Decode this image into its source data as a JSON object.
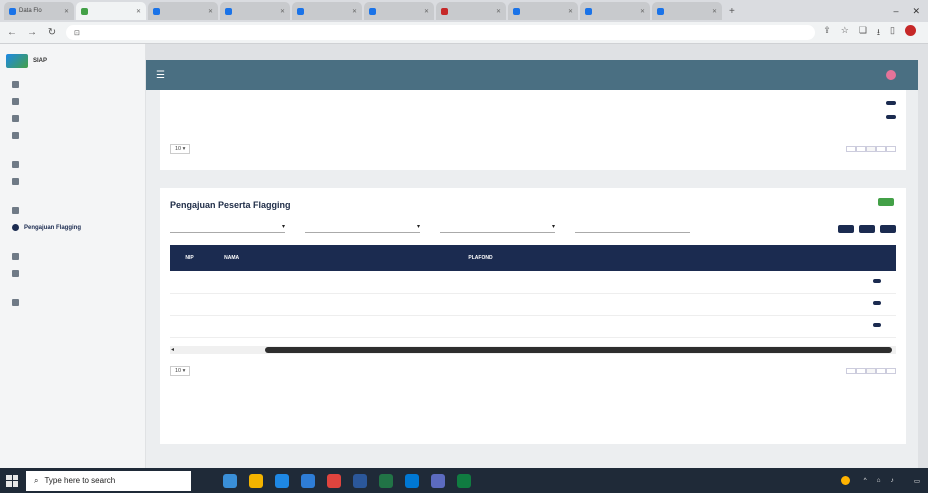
{
  "browser": {
    "tabs": [
      {
        "label": "Data Flo",
        "active": false
      },
      {
        "label": "",
        "active": true
      },
      {
        "label": "",
        "active": false
      },
      {
        "label": "",
        "active": false
      },
      {
        "label": "",
        "active": false
      },
      {
        "label": "",
        "active": false
      },
      {
        "label": "",
        "active": false
      },
      {
        "label": "",
        "active": false
      },
      {
        "label": "",
        "active": false
      },
      {
        "label": "",
        "active": false
      }
    ],
    "url": ""
  },
  "app": {
    "brand_title": "SIAP",
    "brand_subtitle": ""
  },
  "sidebar": {
    "items": [
      {
        "label": "",
        "type": "item"
      },
      {
        "label": "",
        "type": "item"
      },
      {
        "label": "",
        "type": "item"
      },
      {
        "label": "",
        "type": "item"
      },
      {
        "label": "",
        "type": "group"
      },
      {
        "label": "",
        "type": "item"
      },
      {
        "label": "",
        "type": "item"
      },
      {
        "label": "",
        "type": "group"
      },
      {
        "label": "",
        "type": "item"
      },
      {
        "label": "Pengajuan Flagging",
        "type": "item",
        "active": true
      },
      {
        "label": "",
        "type": "group"
      },
      {
        "label": "",
        "type": "item"
      },
      {
        "label": "",
        "type": "item"
      },
      {
        "label": "",
        "type": "group"
      },
      {
        "label": "",
        "type": "item"
      }
    ]
  },
  "topbar": {
    "user_name": "",
    "user_role": ""
  },
  "upper_table": {
    "rows": [
      {
        "cells": [
          "",
          "",
          "",
          "",
          "",
          "",
          "",
          "",
          ""
        ],
        "action": ""
      },
      {
        "cells": [
          "",
          "",
          "",
          "",
          "",
          "",
          "",
          "",
          ""
        ],
        "action": ""
      }
    ],
    "show_value": "10",
    "showing_text": "",
    "pager": [
      "",
      "",
      "",
      "",
      ""
    ]
  },
  "flagging": {
    "title": "Pengajuan Peserta Flagging",
    "add_button": "",
    "filters": [
      {
        "label": "",
        "value": ""
      },
      {
        "label": "",
        "value": ""
      },
      {
        "label": "",
        "value": ""
      },
      {
        "label": "",
        "value": ""
      }
    ],
    "actions": [
      "",
      "",
      ""
    ],
    "columns": [
      "NIP",
      "NAMA",
      "",
      "",
      "",
      "",
      "PLAFOND",
      "",
      "",
      "",
      "",
      "",
      "",
      ""
    ],
    "rows": [
      {
        "cells": [
          "",
          "",
          "",
          "",
          "",
          "",
          "",
          "",
          "",
          "",
          "",
          "",
          ""
        ],
        "action": ""
      },
      {
        "cells": [
          "",
          "",
          "",
          "",
          "",
          "",
          "",
          "",
          "",
          "",
          "",
          "",
          ""
        ],
        "action": ""
      },
      {
        "cells": [
          "",
          "",
          "",
          "",
          "",
          "",
          "",
          "",
          "",
          "",
          "",
          "",
          ""
        ],
        "action": ""
      }
    ],
    "show_value": "10",
    "showing_text": "",
    "pager": [
      "",
      "",
      "",
      "",
      ""
    ]
  },
  "footer": {
    "prefix": "",
    "brand": "",
    "suffix": ""
  },
  "taskbar": {
    "search_placeholder": "Type here to search",
    "weather": "",
    "time": "",
    "date": ""
  }
}
